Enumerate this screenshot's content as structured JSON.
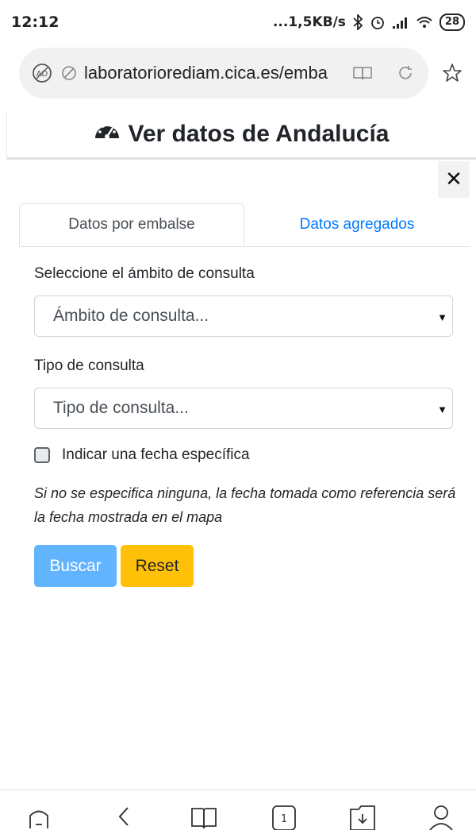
{
  "status": {
    "time": "12:12",
    "network": "...1,5KB/s",
    "battery": "28"
  },
  "browser": {
    "url": "laboratoriorediam.cica.es/emba"
  },
  "page": {
    "title": "Ver datos de Andalucía"
  },
  "tabs": {
    "active": "Datos por embalse",
    "other": "Datos agregados"
  },
  "form": {
    "scope_label": "Seleccione el ámbito de consulta",
    "scope_value": "Ámbito de consulta...",
    "type_label": "Tipo de consulta",
    "type_value": "Tipo de consulta...",
    "date_checkbox": "Indicar una fecha específica",
    "note": "Si no se especifica ninguna, la fecha tomada como referencia será la fecha mostrada en el mapa",
    "search_button": "Buscar",
    "reset_button": "Reset"
  },
  "bottom_nav": {
    "tabs_count": "1"
  },
  "colors": {
    "link": "#007bff",
    "search_btn": "#62b4ff",
    "reset_btn": "#ffc107"
  }
}
